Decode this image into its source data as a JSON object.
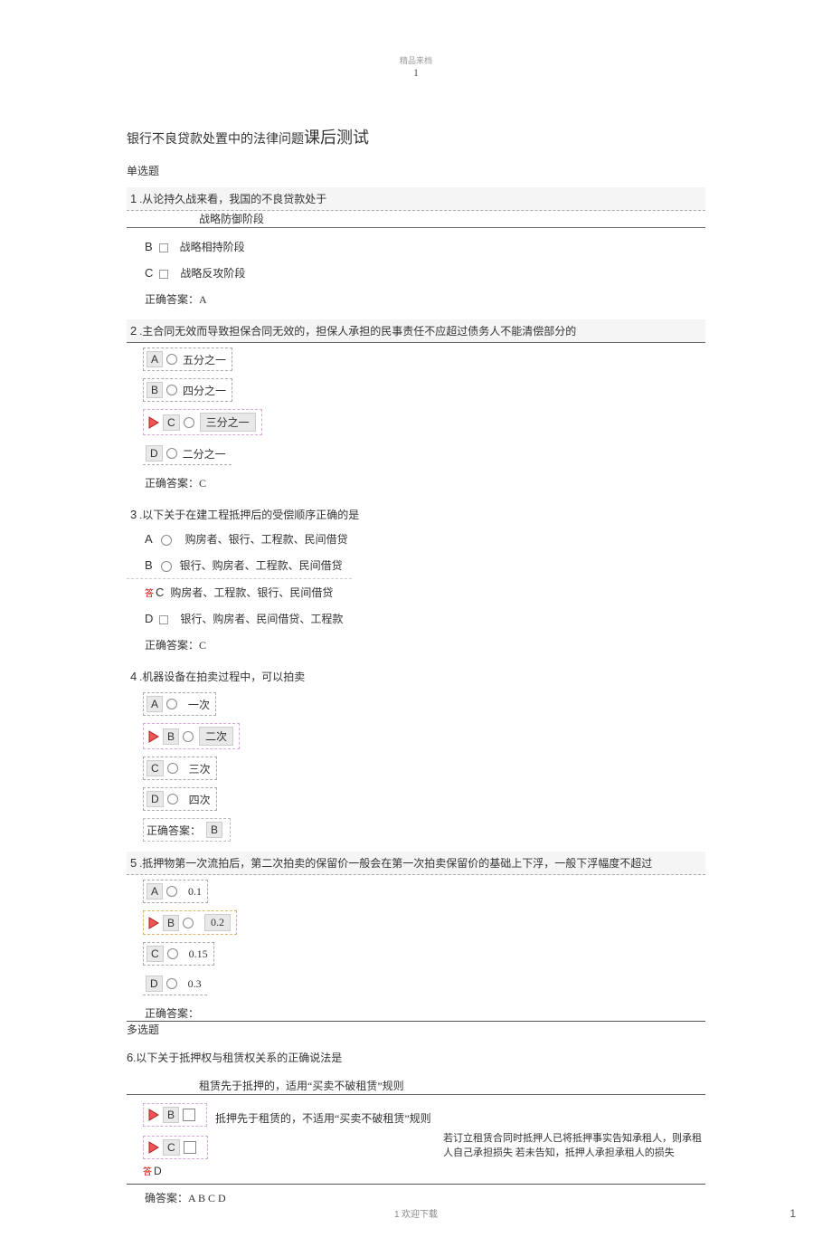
{
  "header": {
    "watermark": "精品来档",
    "page_top": "1"
  },
  "title_prefix": "银行不良贷款处置中的法律问题",
  "title_main": "课后测试",
  "section_single": "单选题",
  "section_multi": "多选题",
  "q1": {
    "num": "1",
    "text": ".从论持久战来看，我国的不良贷款处于",
    "optA": "战略防御阶段",
    "optB_let": "B",
    "optB": "战略相持阶段",
    "optC_let": "C",
    "optC": "战略反攻阶段",
    "correct": "正确答案：A"
  },
  "q2": {
    "num": "2",
    "text": ".主合同无效而导致担保合同无效的，担保人承担的民事责任不应超过债务人不能清偿部分的",
    "A": "A",
    "A_txt": "五分之一",
    "B": "B",
    "B_txt": "四分之一",
    "C": "C",
    "C_txt": "三分之一",
    "D": "D",
    "D_txt": "二分之一",
    "correct": "正确答案：C"
  },
  "q3": {
    "num": "3",
    "text": ".以下关于在建工程抵押后的受偿顺序正确的是",
    "A_let": "A",
    "A": "购房者、银行、工程款、民间借贷",
    "B_let": "B",
    "B": "银行、购房者、工程款、民间借贷",
    "C_let": "C",
    "C_mark": "答",
    "C": "购房者、工程款、银行、民间借贷",
    "D_let": "D",
    "D": "银行、购房者、民间借贷、工程款",
    "correct": "正确答案：C"
  },
  "q4": {
    "num": "4",
    "text": ".机器设备在拍卖过程中，可以拍卖",
    "A": "A",
    "A_txt": "一次",
    "B": "B",
    "B_txt": "二次",
    "C": "C",
    "C_txt": "三次",
    "D": "D",
    "D_txt": "四次",
    "corr_lbl": "正确答案：",
    "corr_val": "B"
  },
  "q5": {
    "num": "5",
    "text": ".抵押物第一次流拍后，第二次拍卖的保留价一般会在第一次拍卖保留价的基础上下浮，一般下浮幅度不超过",
    "A": "A",
    "A_txt": "0.1",
    "B": "B",
    "B_txt": "0.2",
    "C": "C",
    "C_txt": "0.15",
    "D": "D",
    "D_txt": "0.3",
    "correct": "正确答案："
  },
  "q6": {
    "num": "6",
    "text": ".以下关于抵押权与租赁权关系的正确说法是",
    "A_under": "租赁先于抵押的，适用“买卖不破租赁”规则",
    "B": "B",
    "B_txt": "抵押先于租赁的，不适用“买卖不破租赁”规则",
    "C": "C",
    "D_mark": "答",
    "D": "D",
    "right_block": "若订立租赁合同时抵押人已将抵押事实告知承租人，则承租人自己承担损失 若未告知，抵押人承担承租人的损失",
    "correct": "确答案：A B C D"
  },
  "footer": {
    "center_num": "1",
    "center_text": "欢迎下载",
    "right_num": "1"
  }
}
